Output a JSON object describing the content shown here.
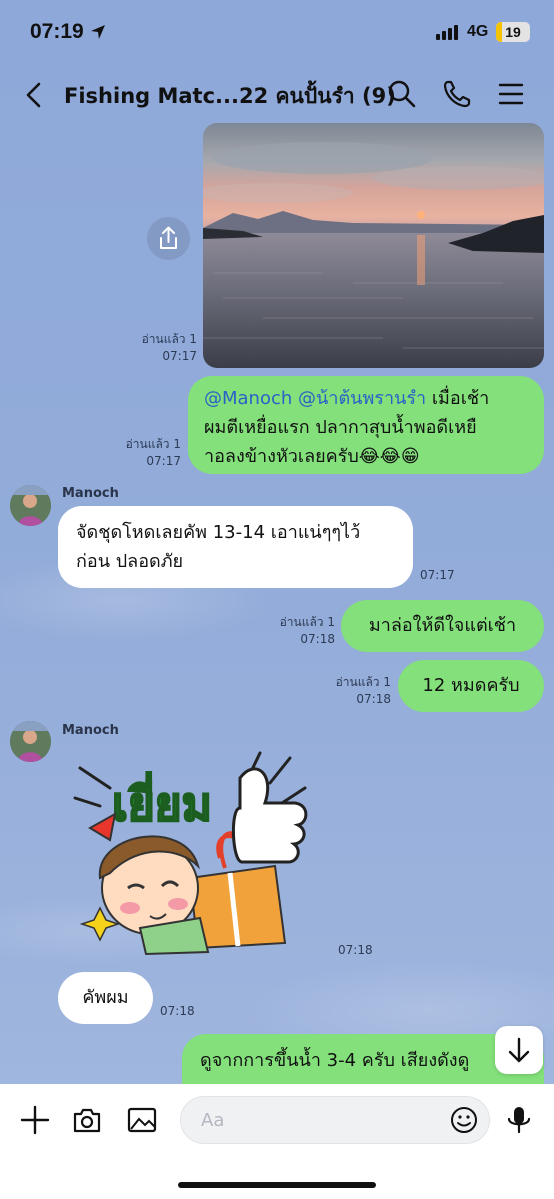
{
  "status_bar": {
    "time": "07:19",
    "network": "4G",
    "battery": "19",
    "battery_level": 0.19
  },
  "header": {
    "title": "Fishing Matc...22 คนปั้นรำ (9)"
  },
  "messages": {
    "m1": {
      "read": "อ่านแล้ว 1",
      "time": "07:17"
    },
    "m2": {
      "read": "อ่านแล้ว 1",
      "time": "07:17",
      "mention1": "@Manoch",
      "mention2": "@น้าต้นพรานรำ",
      "text_a": " เมื่อเช้า",
      "text_b": "ผมตีเหยื่อแรก ปลากาสุบน้ำพอดีเหยื",
      "text_c": "าอลงข้างหัวเลยครับ😂😂😁"
    },
    "m3": {
      "sender": "Manoch",
      "line1": "จัดชุดโหดเลยคัพ 13-14 เอาแน่ๆๆไว้",
      "line2": "ก่อน ปลอดภัย",
      "time": "07:17"
    },
    "m4": {
      "read": "อ่านแล้ว 1",
      "time": "07:18",
      "text": "มาล่อให้ดีใจแต่เช้า"
    },
    "m5": {
      "read": "อ่านแล้ว 1",
      "time": "07:18",
      "text": "12 หมดครับ"
    },
    "m6": {
      "sender": "Manoch",
      "sticker_text": "เยี่ยม",
      "time": "07:18"
    },
    "m7": {
      "text": "คัพผม",
      "time": "07:18"
    },
    "m8": {
      "line1": "ดูจากการขึ้นน้ำ 3-4 ครับ เสียงดังดู",
      "line2": ""
    }
  },
  "input_bar": {
    "placeholder": "Aa"
  },
  "colors": {
    "bubble_out": "#83e07a",
    "bubble_in": "#ffffff",
    "background": "#8fa9d8",
    "mention": "#2a62c7"
  },
  "icons": [
    "location-arrow-icon",
    "back-chevron-icon",
    "search-icon",
    "phone-icon",
    "menu-icon",
    "share-icon",
    "arrow-down-icon",
    "plus-icon",
    "camera-icon",
    "image-icon",
    "emoji-icon",
    "microphone-icon"
  ]
}
